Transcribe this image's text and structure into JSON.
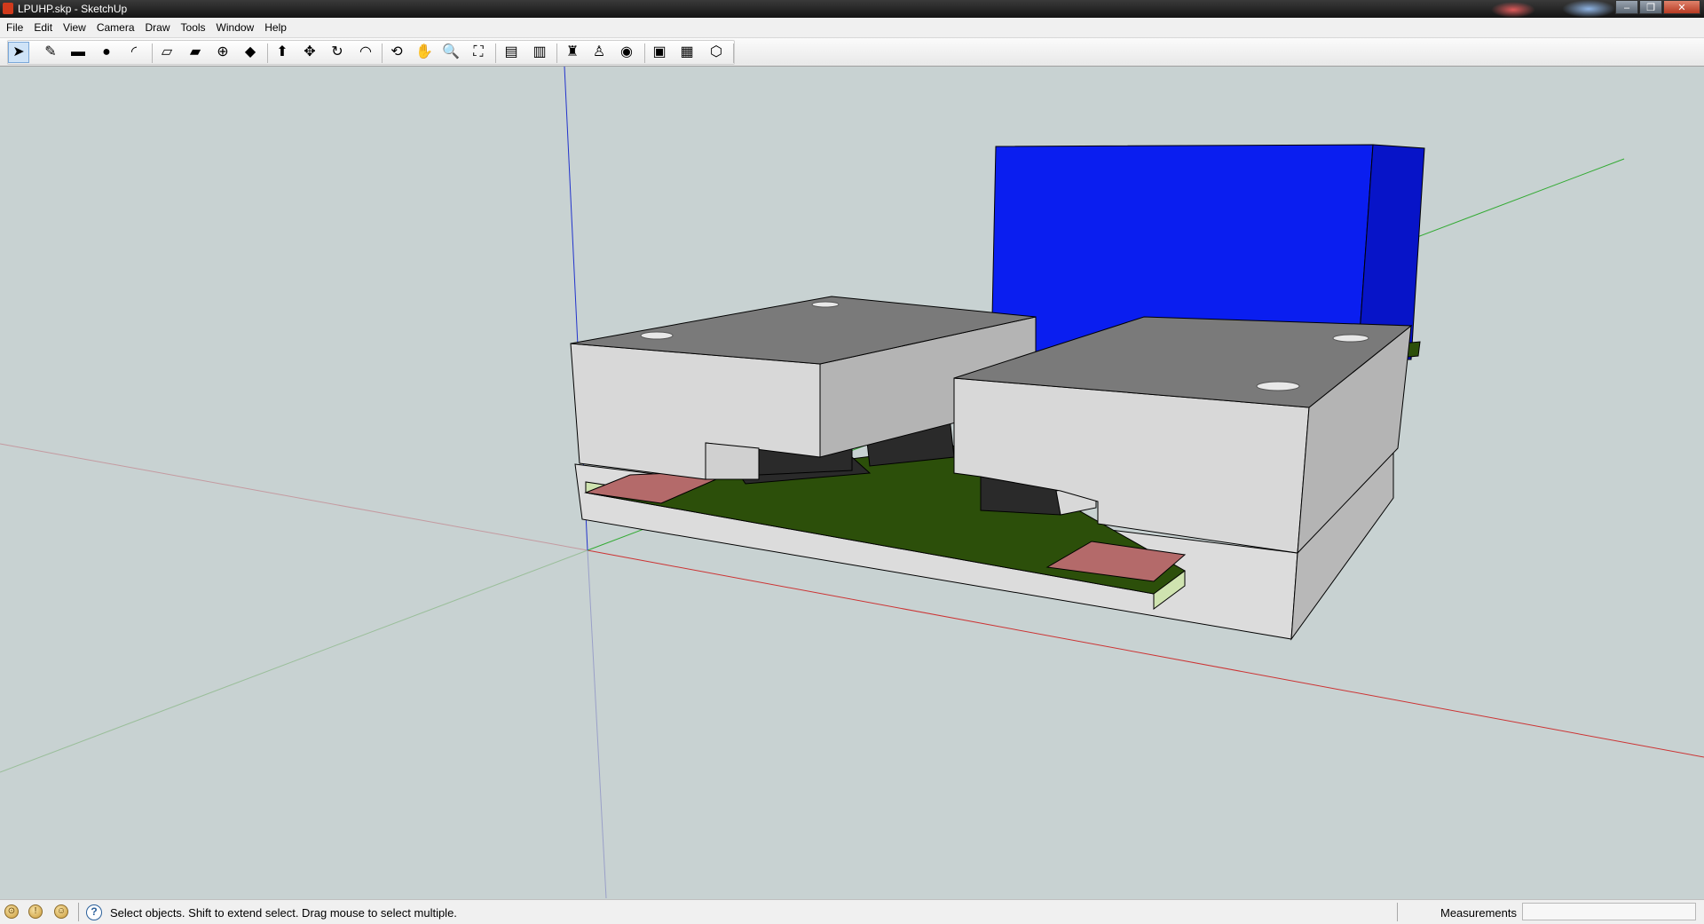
{
  "window": {
    "title": "LPUHP.skp - SketchUp",
    "controls": [
      "minimize-icon",
      "restore-icon",
      "close-icon"
    ]
  },
  "menu": [
    "File",
    "Edit",
    "View",
    "Camera",
    "Draw",
    "Tools",
    "Window",
    "Help"
  ],
  "toolbar": {
    "tools": [
      {
        "name": "select-icon",
        "glyph": "➤",
        "active": true
      },
      {
        "name": "pencil-icon",
        "glyph": "✎"
      },
      {
        "name": "rectangle-icon",
        "glyph": "▬"
      },
      {
        "name": "circle-icon",
        "glyph": "●"
      },
      {
        "name": "arc-icon",
        "glyph": "◜"
      },
      {
        "name": "make-component-icon",
        "glyph": "▱"
      },
      {
        "name": "eraser-icon",
        "glyph": "▰"
      },
      {
        "name": "tape-measure-icon",
        "glyph": "⊕"
      },
      {
        "name": "paint-bucket-icon",
        "glyph": "◆"
      },
      {
        "name": "push-pull-icon",
        "glyph": "⬆"
      },
      {
        "name": "move-icon",
        "glyph": "✥"
      },
      {
        "name": "rotate-icon",
        "glyph": "↻"
      },
      {
        "name": "offset-icon",
        "glyph": "◠"
      },
      {
        "name": "orbit-icon",
        "glyph": "⟲"
      },
      {
        "name": "pan-icon",
        "glyph": "✋"
      },
      {
        "name": "zoom-icon",
        "glyph": "🔍"
      },
      {
        "name": "zoom-extents-icon",
        "glyph": "⛶"
      },
      {
        "name": "previous-view-icon",
        "glyph": "▤"
      },
      {
        "name": "next-view-icon",
        "glyph": "▥"
      },
      {
        "name": "position-camera-icon",
        "glyph": "♜"
      },
      {
        "name": "walk-icon",
        "glyph": "♙"
      },
      {
        "name": "look-around-icon",
        "glyph": "◉"
      },
      {
        "name": "get-models-icon",
        "glyph": "▣"
      },
      {
        "name": "share-model-icon",
        "glyph": "▦"
      },
      {
        "name": "share-component-icon",
        "glyph": "⬡"
      }
    ]
  },
  "scene": {
    "colors": {
      "background": "#c8d2d2",
      "blue_block": "#0a1ef0",
      "blue_block_side": "#0714c8",
      "enclosure_top": "#7a7a7a",
      "enclosure_front": "#d8d8d8",
      "enclosure_side": "#b4b4b4",
      "pcb_green": "#2c4f0a",
      "pcb_edge": "#cfe3b0",
      "pad_red": "#b46a6a",
      "connector": "#2a2a2a",
      "axis_red": "#cc3333",
      "axis_green": "#33aa33",
      "axis_blue": "#2233cc"
    }
  },
  "status": {
    "icons": [
      "geo-location-icon",
      "credits-icon",
      "user-icon"
    ],
    "text": "Select objects. Shift to extend select. Drag mouse to select multiple.",
    "measurements_label": "Measurements",
    "measurements_value": ""
  }
}
